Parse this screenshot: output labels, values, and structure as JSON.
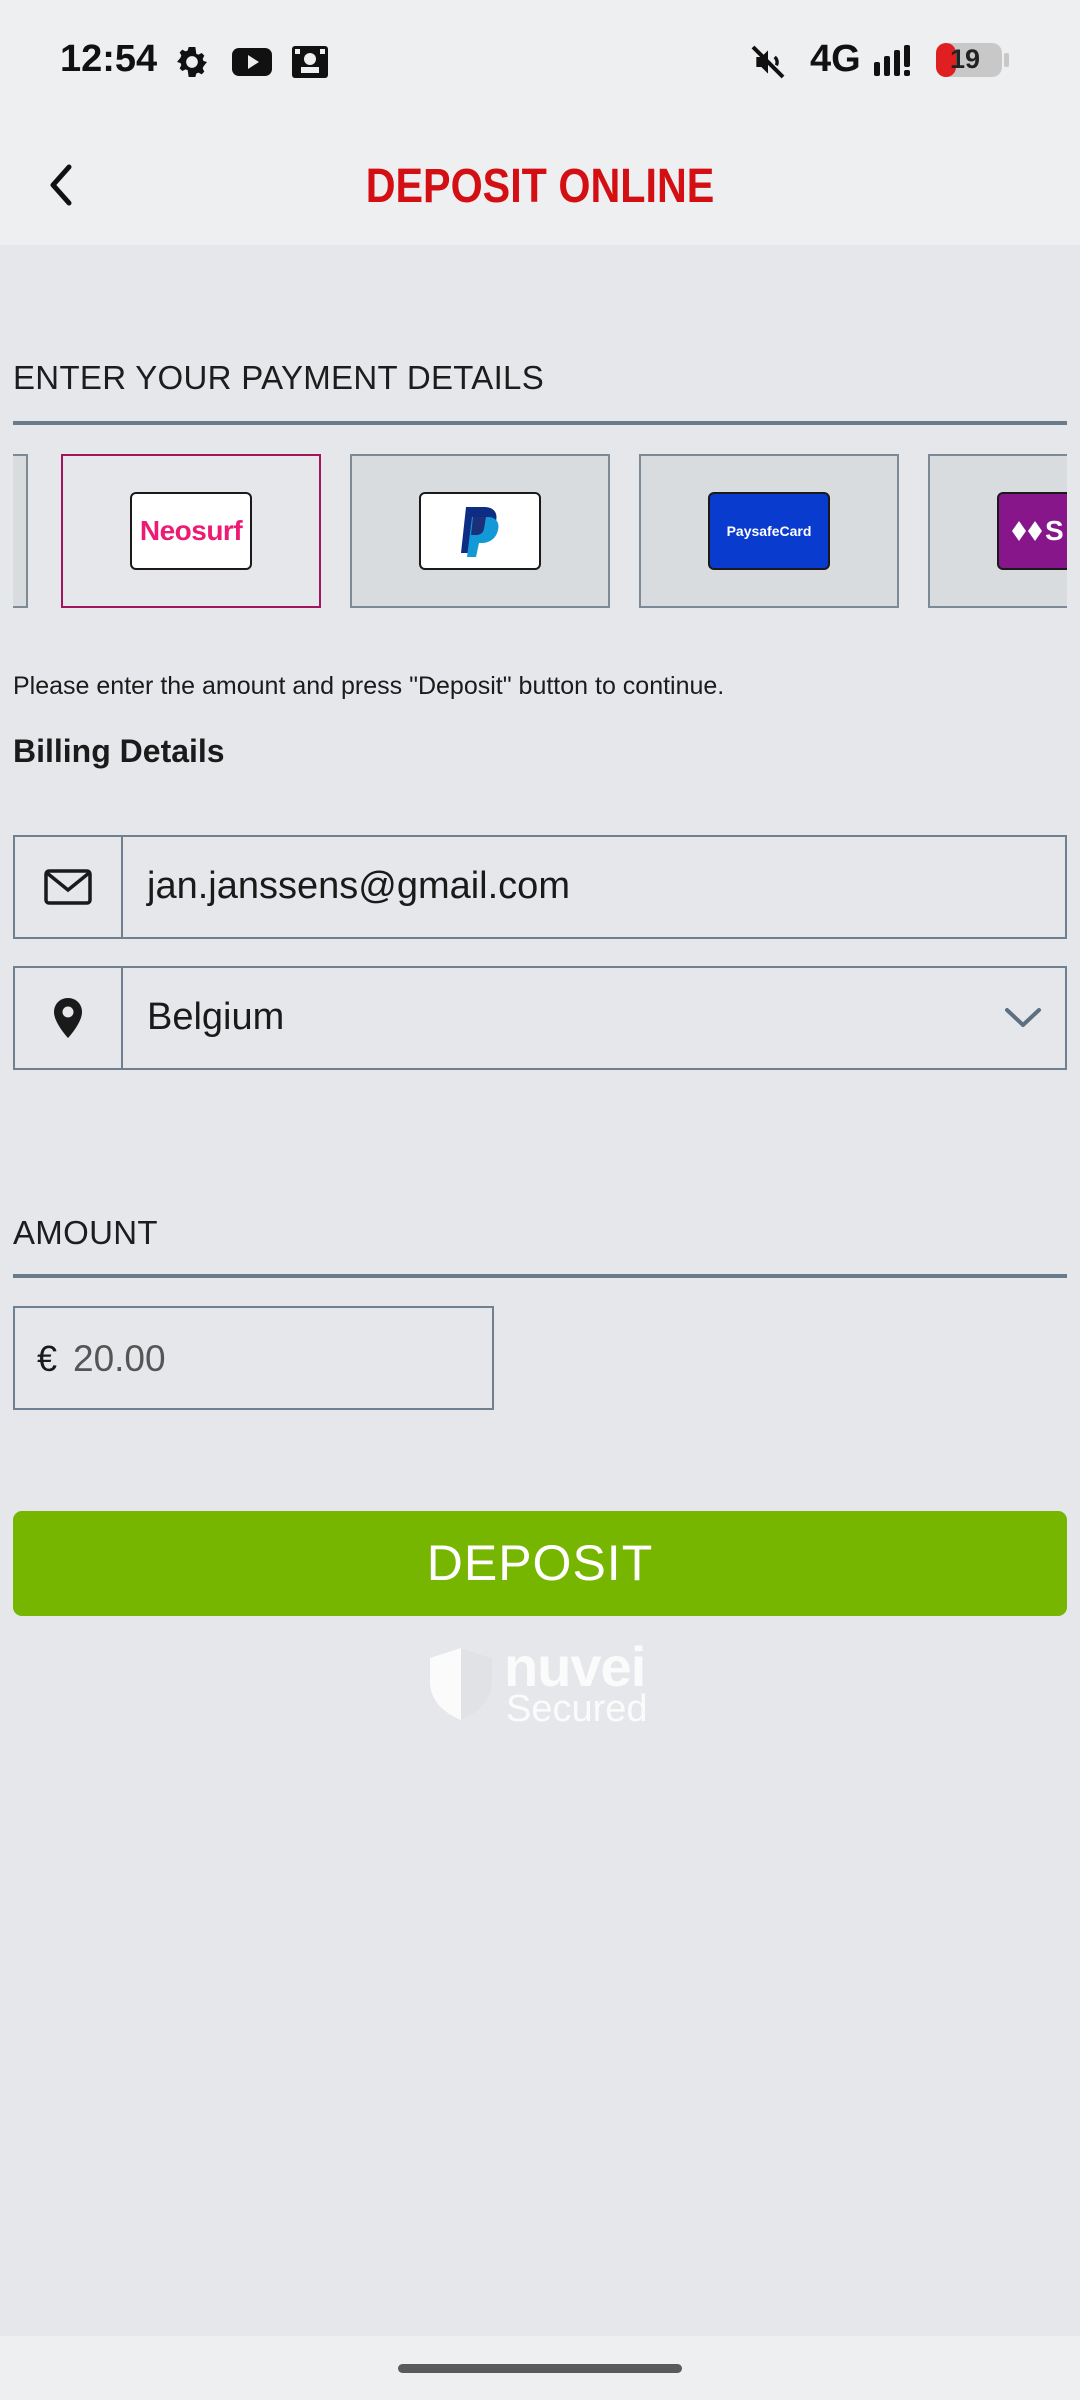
{
  "status_bar": {
    "time": "12:54",
    "icons": [
      "settings-icon",
      "youtube-icon",
      "app-icon",
      "mute-icon"
    ],
    "network": "4G",
    "battery": "19",
    "battery_color": "#e02020"
  },
  "header": {
    "title": "DEPOSIT ONLINE",
    "title_color": "#d40f14"
  },
  "payment": {
    "section_label": "ENTER YOUR PAYMENT DETAILS",
    "methods": [
      {
        "name": "Neosurf",
        "logo": "Neosurf",
        "selected": true
      },
      {
        "name": "PayPal",
        "logo": "paypal-icon",
        "selected": false
      },
      {
        "name": "PaysafeCard",
        "logo": "PaysafeCard",
        "selected": false
      },
      {
        "name": "Skrill",
        "logo": "S",
        "selected": false
      }
    ],
    "selected_border": "#a3145e"
  },
  "hint": "Please enter the amount and press \"Deposit\" button to continue.",
  "billing": {
    "heading": "Billing Details",
    "email": "jan.janssens@gmail.com",
    "country": "Belgium"
  },
  "amount": {
    "section_label": "AMOUNT",
    "currency": "€",
    "placeholder": "20.00"
  },
  "deposit_button": {
    "label": "DEPOSIT",
    "color": "#76b500"
  },
  "badge": {
    "brand": "nuvei",
    "tagline": "Secured"
  }
}
